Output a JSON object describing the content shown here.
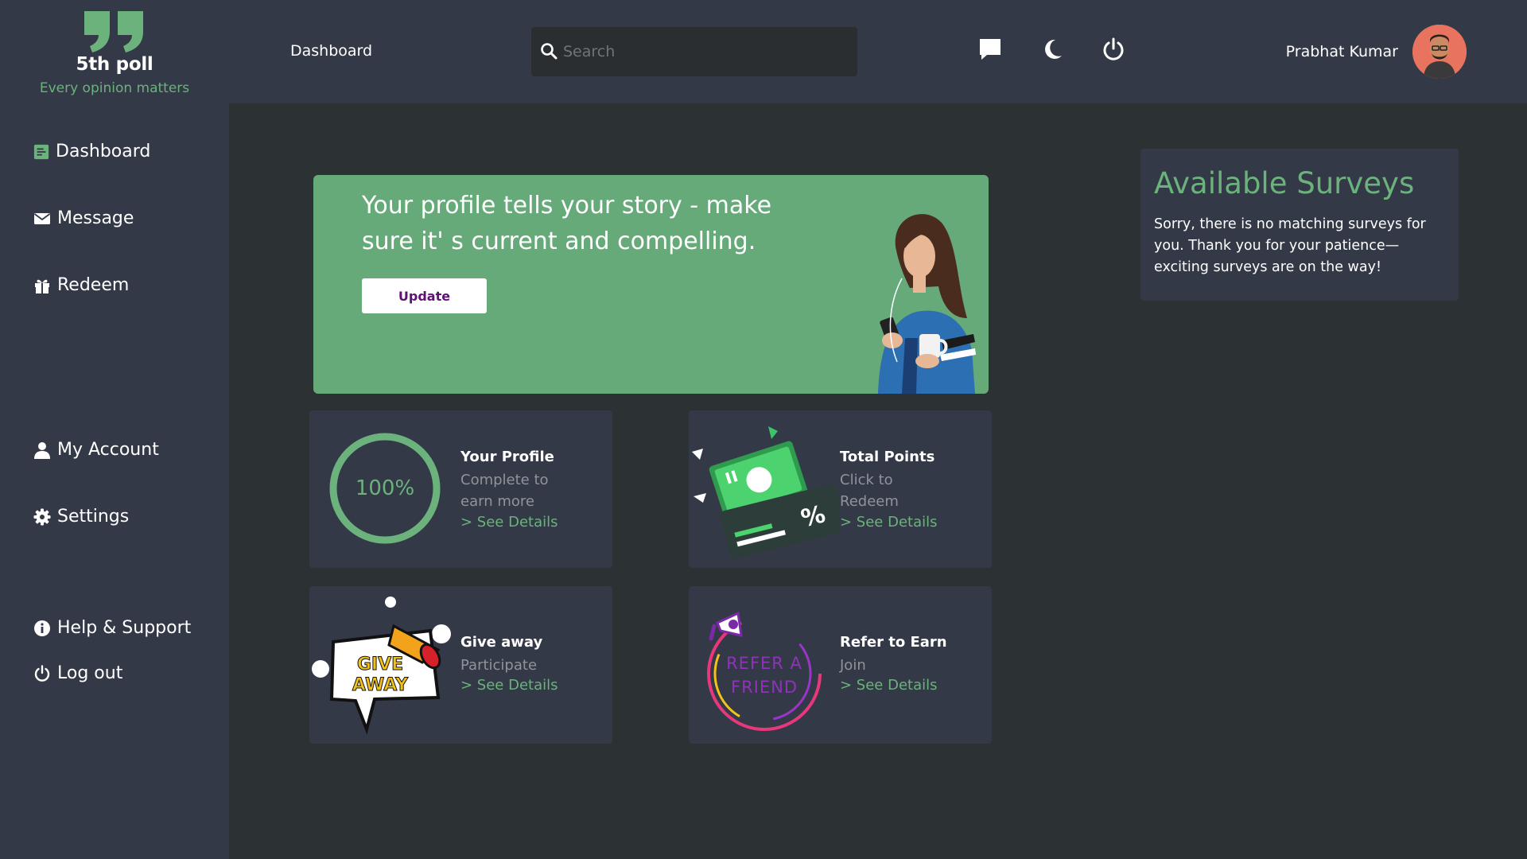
{
  "brand": {
    "name": "5th poll",
    "tagline": "Every opinion matters",
    "accent_color": "#6bb27c"
  },
  "header": {
    "title": "Dashboard",
    "search": {
      "placeholder": "Search",
      "value": ""
    },
    "icons": [
      "chat-icon",
      "moon-icon",
      "power-icon"
    ],
    "user_name": "Prabhat Kumar"
  },
  "sidebar": {
    "items": [
      {
        "label": "Dashboard",
        "icon": "dashboard-icon"
      },
      {
        "label": "Message",
        "icon": "envelope-icon"
      },
      {
        "label": "Redeem",
        "icon": "gift-icon"
      },
      {
        "label": "My Account",
        "icon": "user-icon"
      },
      {
        "label": "Settings",
        "icon": "gear-icon"
      },
      {
        "label": "Help & Support",
        "icon": "info-icon"
      },
      {
        "label": "Log out",
        "icon": "power-icon"
      }
    ]
  },
  "banner": {
    "line1": "Your profile tells your story - make",
    "line2": "sure it' s current and compelling.",
    "button_label": "Update",
    "background_color": "#67aa79"
  },
  "cards": [
    {
      "title": "Your Profile",
      "desc_line1": "Complete to",
      "desc_line2": "earn more",
      "link": "> See Details",
      "progress_label": "100%",
      "progress_fraction": 1.0
    },
    {
      "title": "Total Points",
      "desc_line1": "Click to",
      "desc_line2": "Redeem",
      "link": "> See Details"
    },
    {
      "title": "Give away",
      "desc_line1": "Participate",
      "link": "> See Details",
      "art_text_line1": "GIVE",
      "art_text_line2": "AWAY"
    },
    {
      "title": "Refer to Earn",
      "desc_line1": "Join",
      "link": "> See Details",
      "art_text_line1": "REFER A",
      "art_text_line2": "FRIEND"
    }
  ],
  "surveys": {
    "title": "Available Surveys",
    "message": "Sorry, there is no matching surveys for you. Thank you for your patience—exciting surveys are on the way!"
  }
}
